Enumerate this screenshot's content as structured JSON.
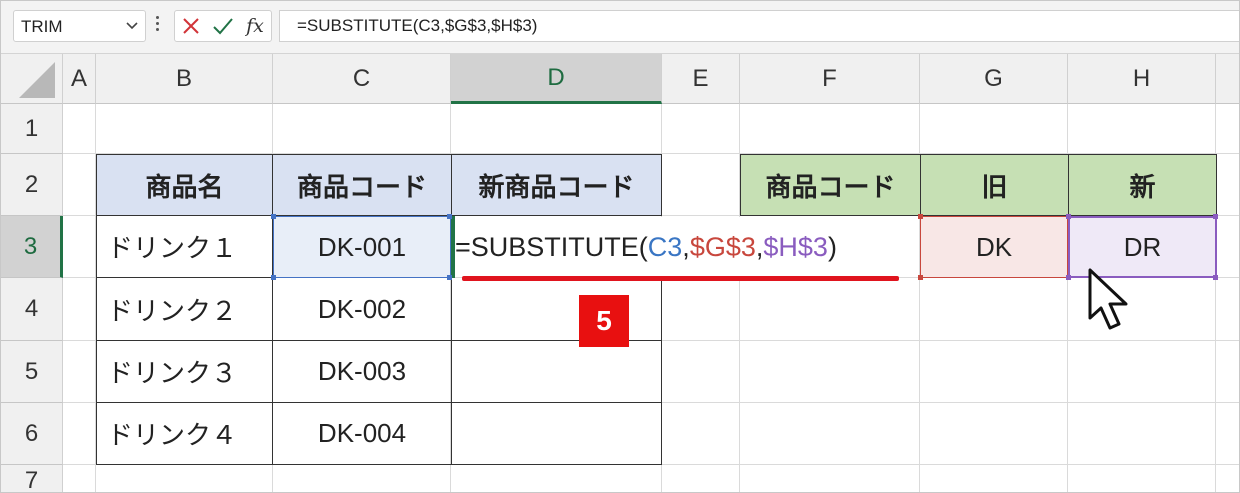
{
  "formula_bar": {
    "name_box": "TRIM",
    "name_box_chevron": "chevron-down-icon",
    "cancel_icon": "close-icon",
    "enter_icon": "check-icon",
    "fx_label": "fx",
    "formula_text": "=SUBSTITUTE(C3,$G$3,$H$3)"
  },
  "columns": [
    "A",
    "B",
    "C",
    "D",
    "E",
    "F",
    "G",
    "H"
  ],
  "rows": [
    "1",
    "2",
    "3",
    "4",
    "5",
    "6",
    "7"
  ],
  "selected_column": "D",
  "selected_row": "3",
  "table1": {
    "headers": [
      "商品名",
      "商品コード",
      "新商品コード"
    ],
    "rows": [
      {
        "name": "ドリンク１",
        "code": "DK-001",
        "new_code": ""
      },
      {
        "name": "ドリンク２",
        "code": "DK-002",
        "new_code": ""
      },
      {
        "name": "ドリンク３",
        "code": "DK-003",
        "new_code": ""
      },
      {
        "name": "ドリンク４",
        "code": "DK-004",
        "new_code": ""
      }
    ]
  },
  "table2": {
    "headers": [
      "商品コード",
      "旧",
      "新"
    ],
    "old_value": "DK",
    "new_value": "DR"
  },
  "editing_formula": {
    "prefix": "=SUBSTITUTE(",
    "ref1": "C3",
    "sep1": ",",
    "ref2": "$G$3",
    "sep2": ",",
    "ref3": "$H$3",
    "suffix": ")"
  },
  "step_badge": "5",
  "colors": {
    "header_blue": "#d9e1f2",
    "header_green": "#c6e0b4",
    "ref_blue": "#3a76c4",
    "ref_red": "#c8473d",
    "ref_purple": "#8a5cbf",
    "badge_red": "#e81010",
    "excel_green": "#217346"
  }
}
